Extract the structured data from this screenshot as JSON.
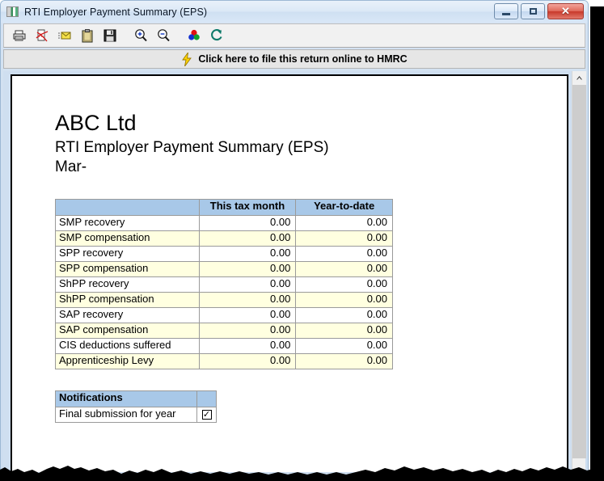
{
  "window": {
    "title": "RTI Employer Payment Summary (EPS)",
    "icon": "report-window-icon",
    "controls": {
      "minimize_label": "–",
      "maximize_label": "□",
      "close_label": "✕"
    }
  },
  "toolbar": {
    "buttons": [
      {
        "name": "print-icon",
        "label": "Print"
      },
      {
        "name": "pdf-export-icon",
        "label": "Export to PDF"
      },
      {
        "name": "email-icon",
        "label": "Email"
      },
      {
        "name": "clipboard-icon",
        "label": "Copy to clipboard"
      },
      {
        "name": "save-icon",
        "label": "Save"
      },
      {
        "name": "zoom-in-icon",
        "label": "Zoom in"
      },
      {
        "name": "zoom-out-icon",
        "label": "Zoom out"
      },
      {
        "name": "color-icon",
        "label": "Colour"
      },
      {
        "name": "refresh-icon",
        "label": "Refresh"
      }
    ]
  },
  "banner": {
    "icon": "lightning-bolt-icon",
    "text": "Click here to file this return online to HMRC"
  },
  "document": {
    "company_name": "ABC Ltd",
    "report_title": "RTI Employer Payment Summary (EPS)",
    "period": "Mar-"
  },
  "amounts_table": {
    "headers": [
      "",
      "This tax month",
      "Year-to-date"
    ],
    "rows": [
      {
        "label": "SMP recovery",
        "this_month": "0.00",
        "ytd": "0.00"
      },
      {
        "label": "SMP compensation",
        "this_month": "0.00",
        "ytd": "0.00"
      },
      {
        "label": "SPP recovery",
        "this_month": "0.00",
        "ytd": "0.00"
      },
      {
        "label": "SPP compensation",
        "this_month": "0.00",
        "ytd": "0.00"
      },
      {
        "label": "ShPP recovery",
        "this_month": "0.00",
        "ytd": "0.00"
      },
      {
        "label": "ShPP compensation",
        "this_month": "0.00",
        "ytd": "0.00"
      },
      {
        "label": "SAP recovery",
        "this_month": "0.00",
        "ytd": "0.00"
      },
      {
        "label": "SAP compensation",
        "this_month": "0.00",
        "ytd": "0.00"
      },
      {
        "label": "CIS deductions suffered",
        "this_month": "0.00",
        "ytd": "0.00"
      },
      {
        "label": "Apprenticeship Levy",
        "this_month": "0.00",
        "ytd": "0.00"
      }
    ]
  },
  "notifications_table": {
    "header": "Notifications",
    "rows": [
      {
        "label": "Final submission for year",
        "checked": true,
        "check_mark": "✓"
      }
    ]
  },
  "scrollbar": {
    "up_arrow": "▲"
  },
  "colors": {
    "table_header_blue": "#a8c8e8",
    "alt_row_cream": "#ffffe0",
    "window_chrome": "#cfdff0",
    "close_button_red": "#c8392b"
  }
}
